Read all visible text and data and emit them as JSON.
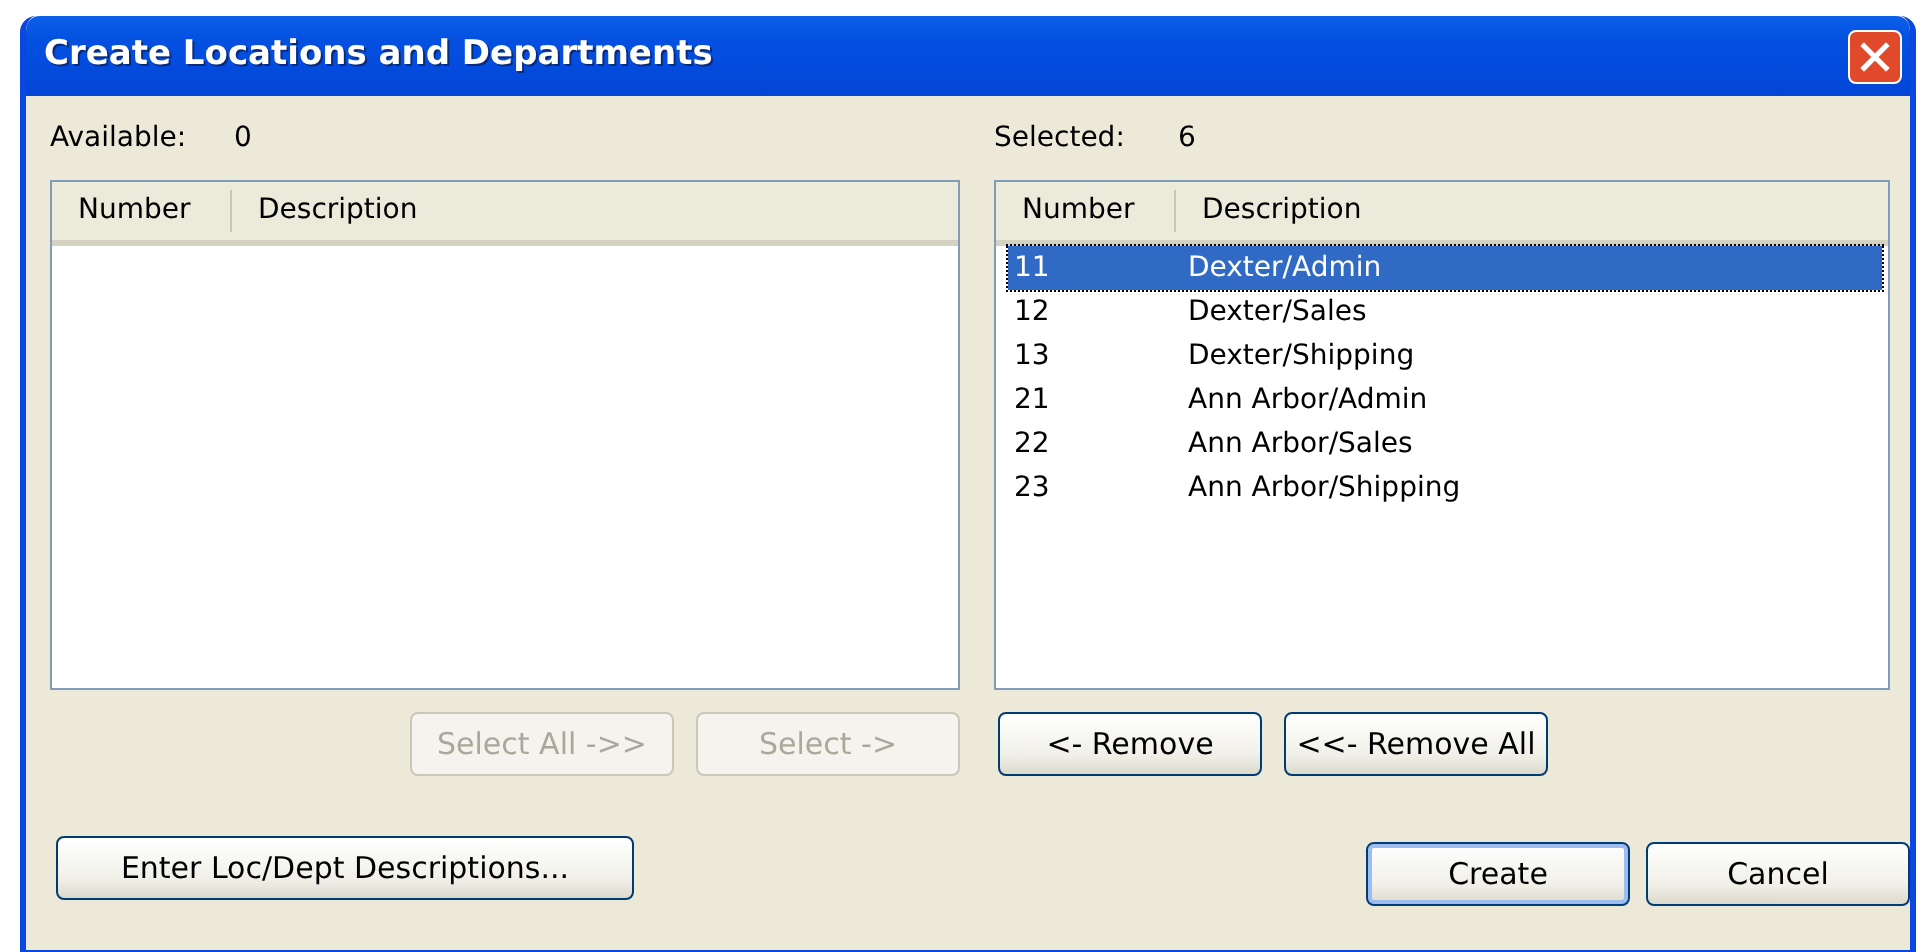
{
  "window": {
    "title": "Create Locations and Departments"
  },
  "available": {
    "label": "Available:",
    "count": "0",
    "columns": [
      "Number",
      "Description"
    ],
    "buttons": [
      {
        "label": "Select All ->>",
        "disabled": true
      },
      {
        "label": "Select ->",
        "disabled": true
      }
    ]
  },
  "selected": {
    "label": "Selected:",
    "count": "6",
    "columns": [
      "Number",
      "Description"
    ],
    "rows": [
      {
        "number": "11",
        "description": "Dexter/Admin",
        "selected": true
      },
      {
        "number": "12",
        "description": "Dexter/Sales",
        "selected": false
      },
      {
        "number": "13",
        "description": "Dexter/Shipping",
        "selected": false
      },
      {
        "number": "21",
        "description": "Ann Arbor/Admin",
        "selected": false
      },
      {
        "number": "22",
        "description": "Ann Arbor/Sales",
        "selected": false
      },
      {
        "number": "23",
        "description": "Ann Arbor/Shipping",
        "selected": false
      }
    ],
    "buttons": [
      {
        "label": "<- Remove",
        "disabled": false
      },
      {
        "label": "<<- Remove All",
        "disabled": false
      }
    ]
  },
  "footer": {
    "left_button": {
      "label": "Enter Loc/Dept Descriptions...",
      "default": false
    },
    "buttons": [
      {
        "label": "Create",
        "default": true
      },
      {
        "label": "Cancel",
        "default": false
      }
    ]
  }
}
